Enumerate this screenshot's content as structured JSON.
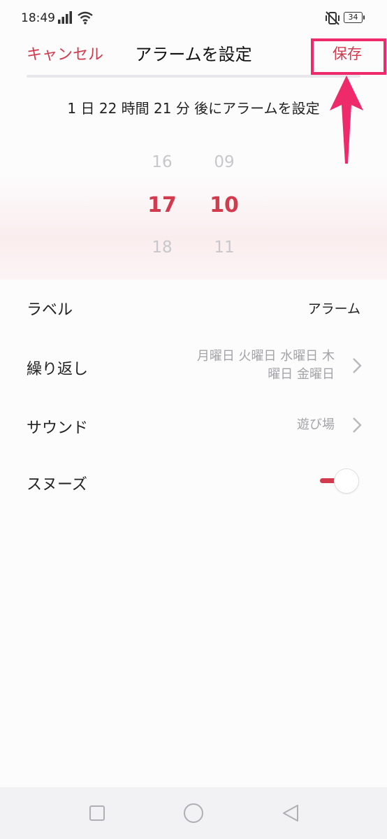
{
  "status_bar": {
    "time": "18:49",
    "battery": "34",
    "icons": [
      "signal-icon",
      "wifi-icon",
      "vibrate-off-icon",
      "battery-icon"
    ]
  },
  "header": {
    "cancel_label": "キャンセル",
    "title": "アラームを設定",
    "save_label": "保存"
  },
  "countdown": "1 日 22 時間 21 分 後にアラームを設定",
  "picker": {
    "hour": {
      "prev": "16",
      "selected": "17",
      "next": "18"
    },
    "minute": {
      "prev": "09",
      "selected": "10",
      "next": "11"
    }
  },
  "settings": {
    "label": {
      "title": "ラベル",
      "value": "アラーム"
    },
    "repeat": {
      "title": "繰り返し",
      "value_line1": "月曜日 火曜日 水曜日 木",
      "value_line2": "曜日 金曜日"
    },
    "sound": {
      "title": "サウンド",
      "value": "遊び場"
    },
    "snooze": {
      "title": "スヌーズ",
      "enabled": true
    }
  },
  "colors": {
    "accent": "#d23b4e",
    "annotation": "#ee2a6b",
    "muted": "#a3a3a8"
  },
  "nav_bar": {
    "icons": [
      "recents-square-icon",
      "home-circle-icon",
      "back-triangle-icon"
    ]
  }
}
